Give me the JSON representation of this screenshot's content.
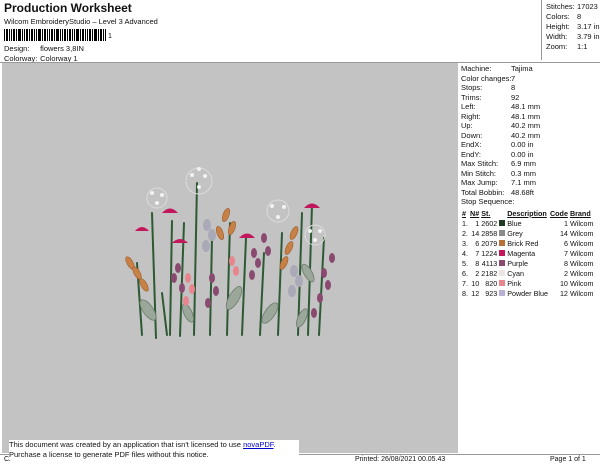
{
  "header": {
    "title": "Production Worksheet",
    "subtitle": "Wilcom EmbroideryStudio – Level 3 Advanced",
    "barcode_suffix": "1",
    "design_label": "Design:",
    "design_value": "flowers 3,8IN",
    "colorway_label": "Colorway:",
    "colorway_value": "Colorway 1"
  },
  "summary": [
    {
      "label": "Stitches:",
      "value": "17023"
    },
    {
      "label": "Colors:",
      "value": "8"
    },
    {
      "label": "Height:",
      "value": "3.17 in"
    },
    {
      "label": "Width:",
      "value": "3.79 in"
    },
    {
      "label": "Zoom:",
      "value": "1:1"
    }
  ],
  "machine_info": [
    {
      "label": "Machine:",
      "value": "Tajima"
    },
    {
      "label": "Color changes:",
      "value": "7"
    },
    {
      "label": "Stops:",
      "value": "8"
    },
    {
      "label": "Trims:",
      "value": "92"
    },
    {
      "label": "Left:",
      "value": "48.1 mm"
    },
    {
      "label": "Right:",
      "value": "48.1 mm"
    },
    {
      "label": "Up:",
      "value": "40.2 mm"
    },
    {
      "label": "Down:",
      "value": "40.2 mm"
    },
    {
      "label": "EndX:",
      "value": "0.00 in"
    },
    {
      "label": "EndY:",
      "value": "0.00 in"
    },
    {
      "label": "Max Stitch:",
      "value": "6.9 mm"
    },
    {
      "label": "Min Stitch:",
      "value": "0.3 mm"
    },
    {
      "label": "Max Jump:",
      "value": "7.1 mm"
    },
    {
      "label": "Total Bobbin:",
      "value": "48.68ft"
    }
  ],
  "stop_sequence": {
    "title": "Stop Sequence:",
    "headers": [
      "#",
      "N#",
      "St.",
      "Description",
      "Code",
      "Brand"
    ],
    "rows": [
      {
        "num": "1.",
        "n": "1",
        "st": "2602",
        "color": "#1f3b22",
        "desc": "Blue",
        "code": "1",
        "brand": "Wilcom"
      },
      {
        "num": "2.",
        "n": "14",
        "st": "2858",
        "color": "#8b8b8b",
        "desc": "Grey",
        "code": "14",
        "brand": "Wilcom"
      },
      {
        "num": "3.",
        "n": "6",
        "st": "2079",
        "color": "#b8703a",
        "desc": "Brick Red",
        "code": "6",
        "brand": "Wilcom"
      },
      {
        "num": "4.",
        "n": "7",
        "st": "1224",
        "color": "#c2185b",
        "desc": "Magenta",
        "code": "7",
        "brand": "Wilcom"
      },
      {
        "num": "5.",
        "n": "8",
        "st": "4113",
        "color": "#8a4a70",
        "desc": "Purple",
        "code": "8",
        "brand": "Wilcom"
      },
      {
        "num": "6.",
        "n": "2",
        "st": "2182",
        "color": "#ede4e4",
        "desc": "Cyan",
        "code": "2",
        "brand": "Wilcom"
      },
      {
        "num": "7.",
        "n": "10",
        "st": "820",
        "color": "#e8858e",
        "desc": "Pink",
        "code": "10",
        "brand": "Wilcom"
      },
      {
        "num": "8.",
        "n": "12",
        "st": "923",
        "color": "#b9b0d6",
        "desc": "Powder Blue",
        "code": "12",
        "brand": "Wilcom"
      }
    ]
  },
  "footer": {
    "left_stub": "Cr",
    "notice_line1": "This document was created by an application that isn't licensed to use ",
    "notice_link": "novaPDF",
    "notice_line1_end": ".",
    "notice_line2": "Purchase a license to generate PDF files without this notice.",
    "printed": "Printed: 26/08/2021 00.05.43",
    "page": "Page 1 of 1"
  }
}
